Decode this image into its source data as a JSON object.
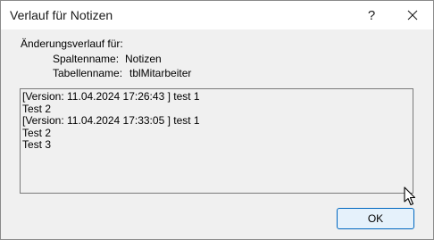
{
  "window": {
    "title": "Verlauf für Notizen",
    "help_glyph": "?",
    "close_glyph": "✕"
  },
  "info": {
    "heading": "Änderungsverlauf für:",
    "column_label": "Spaltenname:",
    "column_value": "Notizen",
    "table_label": "Tabellenname:",
    "table_value": "tblMitarbeiter"
  },
  "history": {
    "lines": [
      "[Version: 11.04.2024 17:26:43 ] test 1",
      "Test 2",
      "[Version: 11.04.2024 17:33:05 ] test 1",
      "Test 2",
      "Test 3"
    ]
  },
  "buttons": {
    "ok_label": "OK"
  },
  "colors": {
    "accent": "#0067c0",
    "dialog_background": "#f0f0f0",
    "titlebar_background": "#ffffff"
  }
}
